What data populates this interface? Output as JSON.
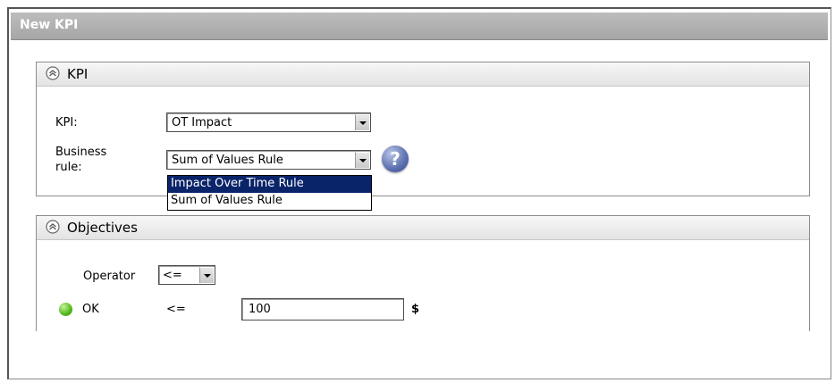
{
  "dialog": {
    "title": "New KPI"
  },
  "kpi_panel": {
    "title": "KPI",
    "kpi_label": "KPI:",
    "kpi_value": "OT Impact",
    "business_rule_label_line1": "Business",
    "business_rule_label_line2": "rule:",
    "business_rule_value": "Sum of Values Rule",
    "business_rule_options": [
      "Impact Over Time Rule",
      "Sum of Values Rule"
    ],
    "highlighted_option": "Impact Over Time Rule",
    "help_glyph": "?"
  },
  "objectives_panel": {
    "title": "Objectives",
    "operator_label": "Operator",
    "operator_value": "<=",
    "rows": [
      {
        "status_color": "#4fb81c",
        "label": "OK",
        "operator": "<=",
        "value": "100",
        "unit": "$"
      }
    ]
  }
}
